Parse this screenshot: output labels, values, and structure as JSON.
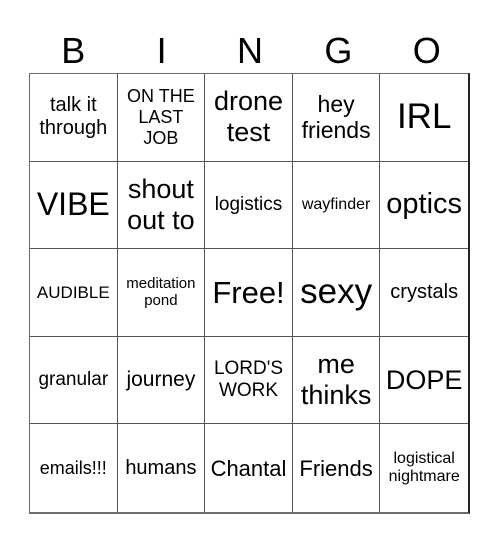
{
  "header": {
    "letters": [
      "B",
      "I",
      "N",
      "G",
      "O"
    ]
  },
  "cells": [
    {
      "text": "talk it through",
      "size": 20
    },
    {
      "text": "ON THE LAST JOB",
      "size": 18
    },
    {
      "text": "drone test",
      "size": 27
    },
    {
      "text": "hey friends",
      "size": 23
    },
    {
      "text": "IRL",
      "size": 35
    },
    {
      "text": "VIBE",
      "size": 32
    },
    {
      "text": "shout out to",
      "size": 27
    },
    {
      "text": "logistics",
      "size": 19
    },
    {
      "text": "wayfinder",
      "size": 16
    },
    {
      "text": "optics",
      "size": 29
    },
    {
      "text": "AUDIBLE",
      "size": 17
    },
    {
      "text": "meditation pond",
      "size": 15
    },
    {
      "text": "Free!",
      "size": 31
    },
    {
      "text": "sexy",
      "size": 35
    },
    {
      "text": "crystals",
      "size": 20
    },
    {
      "text": "granular",
      "size": 19
    },
    {
      "text": "journey",
      "size": 21
    },
    {
      "text": "LORD'S WORK",
      "size": 19
    },
    {
      "text": "me thinks",
      "size": 27
    },
    {
      "text": "DOPE",
      "size": 27
    },
    {
      "text": "emails!!!",
      "size": 18
    },
    {
      "text": "humans",
      "size": 20
    },
    {
      "text": "Chantal",
      "size": 22
    },
    {
      "text": "Friends",
      "size": 22
    },
    {
      "text": "logistical nightmare",
      "size": 16
    }
  ]
}
